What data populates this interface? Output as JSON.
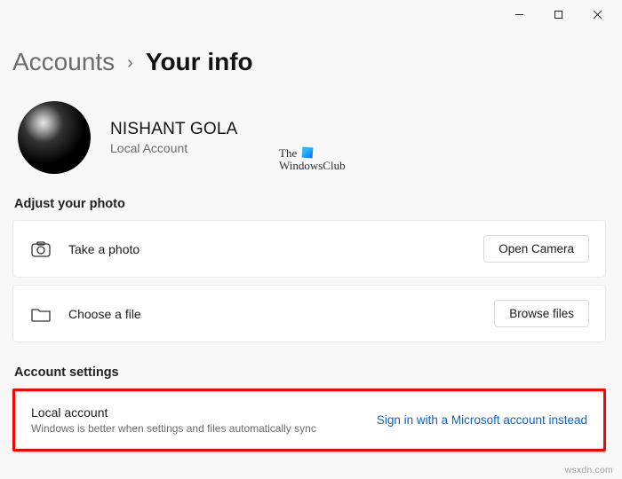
{
  "titlebar": {
    "minimize": "minimize",
    "maximize": "maximize",
    "close": "close"
  },
  "breadcrumb": {
    "parent": "Accounts",
    "sep": "›",
    "current": "Your info"
  },
  "profile": {
    "name": "NISHANT GOLA",
    "type": "Local Account"
  },
  "watermark": {
    "line1": "The",
    "line2": "WindowsClub"
  },
  "sections": {
    "adjust_photo_label": "Adjust your photo",
    "account_settings_label": "Account settings"
  },
  "photo_rows": [
    {
      "icon": "camera",
      "label": "Take a photo",
      "button": "Open Camera"
    },
    {
      "icon": "folder",
      "label": "Choose a file",
      "button": "Browse files"
    }
  ],
  "account_row": {
    "title": "Local account",
    "subtitle": "Windows is better when settings and files automatically sync",
    "link": "Sign in with a Microsoft account instead"
  },
  "footer": "wsxdn.com"
}
